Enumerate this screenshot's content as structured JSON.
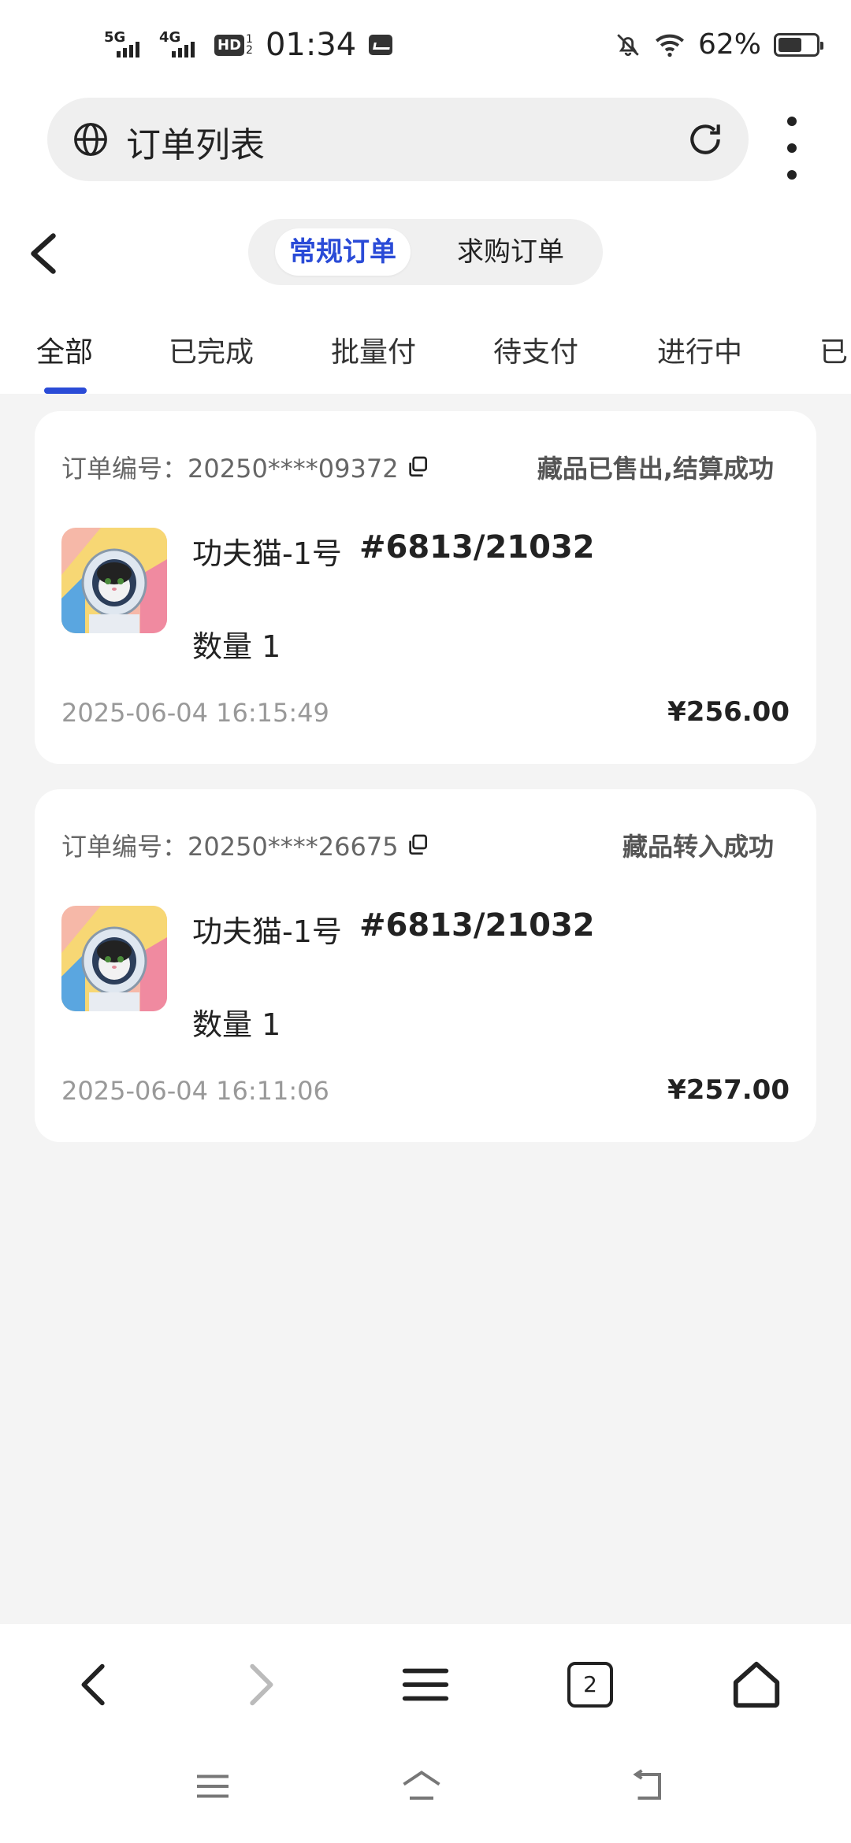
{
  "status_bar": {
    "signal1_label": "5G",
    "signal2_label": "4G",
    "hd_label": "HD",
    "hd_sub_top": "1",
    "hd_sub_bottom": "2",
    "time": "01:34",
    "battery": "62%",
    "battery_level": 0.62
  },
  "address_bar": {
    "title": "订单列表"
  },
  "segment": {
    "items": [
      {
        "label": "常规订单",
        "active": true
      },
      {
        "label": "求购订单",
        "active": false
      }
    ]
  },
  "tabs": {
    "items": [
      {
        "label": "全部",
        "active": true
      },
      {
        "label": "已完成"
      },
      {
        "label": "批量付"
      },
      {
        "label": "待支付"
      },
      {
        "label": "进行中"
      },
      {
        "label": "已"
      }
    ]
  },
  "orders": [
    {
      "order_no": "订单编号：20250****09372",
      "status": "藏品已售出,结算成功",
      "name": "功夫猫-1号",
      "serial": "#6813/21032",
      "quantity": "数量 1",
      "time": "2025-06-04 16:15:49",
      "price": "¥256.00"
    },
    {
      "order_no": "订单编号：20250****26675",
      "status": "藏品转入成功",
      "name": "功夫猫-1号",
      "serial": "#6813/21032",
      "quantity": "数量 1",
      "time": "2025-06-04 16:11:06",
      "price": "¥257.00"
    }
  ],
  "browser_bar": {
    "tab_count": "2",
    "icons": [
      "back-icon",
      "forward-icon",
      "menu-icon",
      "tabs-icon",
      "home-icon"
    ]
  },
  "colors": {
    "accent": "#2a4bd7",
    "background": "#f4f4f4",
    "muted_text": "#999999"
  }
}
